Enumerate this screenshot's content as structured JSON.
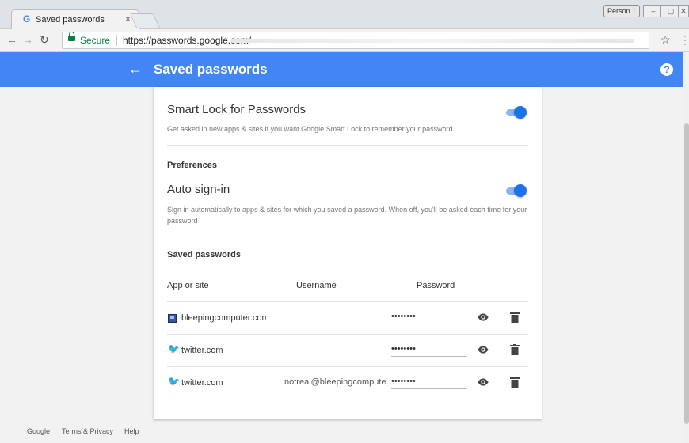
{
  "browser": {
    "tab_title": "Saved passwords",
    "tab_favicon": "G",
    "tab_close": "×",
    "profile_badge": "Person 1",
    "secure_label": "Secure",
    "url": "https://passwords.google.com/"
  },
  "appbar": {
    "title": "Saved passwords",
    "color": "#4285f4"
  },
  "smart_lock": {
    "title": "Smart Lock for Passwords",
    "description": "Get asked in new apps & sites if you want Google Smart Lock to remember your password",
    "enabled": true
  },
  "preferences": {
    "heading": "Preferences",
    "auto_signin": {
      "title": "Auto sign-in",
      "description": "Sign in automatically to apps & sites for which you saved a password. When off, you'll be asked each time for your password",
      "enabled": true
    }
  },
  "saved": {
    "heading": "Saved passwords",
    "columns": {
      "site": "App or site",
      "username": "Username",
      "password": "Password"
    },
    "rows": [
      {
        "site": "bleepingcomputer.com",
        "username": "",
        "password": "••••••••",
        "icon": "bleepingcomputer-icon"
      },
      {
        "site": "twitter.com",
        "username": "",
        "password": "••••••••",
        "icon": "twitter-icon"
      },
      {
        "site": "twitter.com",
        "username": "notreal@bleepingcomputer.com",
        "password": "••••••••",
        "icon": "twitter-icon"
      }
    ]
  },
  "footer": {
    "google": "Google",
    "terms": "Terms & Privacy",
    "help": "Help"
  }
}
